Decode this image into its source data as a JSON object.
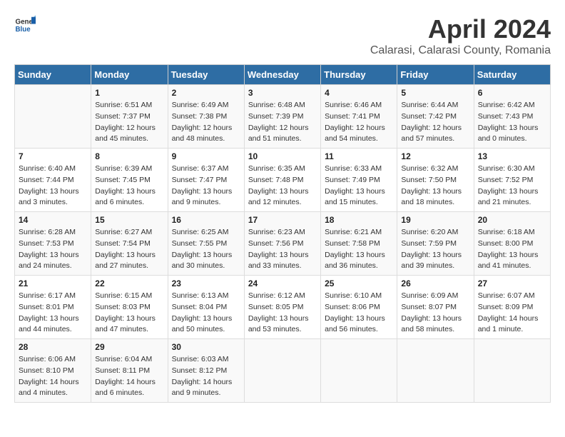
{
  "header": {
    "logo_general": "General",
    "logo_blue": "Blue",
    "title": "April 2024",
    "subtitle": "Calarasi, Calarasi County, Romania"
  },
  "calendar": {
    "days_of_week": [
      "Sunday",
      "Monday",
      "Tuesday",
      "Wednesday",
      "Thursday",
      "Friday",
      "Saturday"
    ],
    "weeks": [
      [
        {
          "day": "",
          "info": ""
        },
        {
          "day": "1",
          "info": "Sunrise: 6:51 AM\nSunset: 7:37 PM\nDaylight: 12 hours\nand 45 minutes."
        },
        {
          "day": "2",
          "info": "Sunrise: 6:49 AM\nSunset: 7:38 PM\nDaylight: 12 hours\nand 48 minutes."
        },
        {
          "day": "3",
          "info": "Sunrise: 6:48 AM\nSunset: 7:39 PM\nDaylight: 12 hours\nand 51 minutes."
        },
        {
          "day": "4",
          "info": "Sunrise: 6:46 AM\nSunset: 7:41 PM\nDaylight: 12 hours\nand 54 minutes."
        },
        {
          "day": "5",
          "info": "Sunrise: 6:44 AM\nSunset: 7:42 PM\nDaylight: 12 hours\nand 57 minutes."
        },
        {
          "day": "6",
          "info": "Sunrise: 6:42 AM\nSunset: 7:43 PM\nDaylight: 13 hours\nand 0 minutes."
        }
      ],
      [
        {
          "day": "7",
          "info": "Sunrise: 6:40 AM\nSunset: 7:44 PM\nDaylight: 13 hours\nand 3 minutes."
        },
        {
          "day": "8",
          "info": "Sunrise: 6:39 AM\nSunset: 7:45 PM\nDaylight: 13 hours\nand 6 minutes."
        },
        {
          "day": "9",
          "info": "Sunrise: 6:37 AM\nSunset: 7:47 PM\nDaylight: 13 hours\nand 9 minutes."
        },
        {
          "day": "10",
          "info": "Sunrise: 6:35 AM\nSunset: 7:48 PM\nDaylight: 13 hours\nand 12 minutes."
        },
        {
          "day": "11",
          "info": "Sunrise: 6:33 AM\nSunset: 7:49 PM\nDaylight: 13 hours\nand 15 minutes."
        },
        {
          "day": "12",
          "info": "Sunrise: 6:32 AM\nSunset: 7:50 PM\nDaylight: 13 hours\nand 18 minutes."
        },
        {
          "day": "13",
          "info": "Sunrise: 6:30 AM\nSunset: 7:52 PM\nDaylight: 13 hours\nand 21 minutes."
        }
      ],
      [
        {
          "day": "14",
          "info": "Sunrise: 6:28 AM\nSunset: 7:53 PM\nDaylight: 13 hours\nand 24 minutes."
        },
        {
          "day": "15",
          "info": "Sunrise: 6:27 AM\nSunset: 7:54 PM\nDaylight: 13 hours\nand 27 minutes."
        },
        {
          "day": "16",
          "info": "Sunrise: 6:25 AM\nSunset: 7:55 PM\nDaylight: 13 hours\nand 30 minutes."
        },
        {
          "day": "17",
          "info": "Sunrise: 6:23 AM\nSunset: 7:56 PM\nDaylight: 13 hours\nand 33 minutes."
        },
        {
          "day": "18",
          "info": "Sunrise: 6:21 AM\nSunset: 7:58 PM\nDaylight: 13 hours\nand 36 minutes."
        },
        {
          "day": "19",
          "info": "Sunrise: 6:20 AM\nSunset: 7:59 PM\nDaylight: 13 hours\nand 39 minutes."
        },
        {
          "day": "20",
          "info": "Sunrise: 6:18 AM\nSunset: 8:00 PM\nDaylight: 13 hours\nand 41 minutes."
        }
      ],
      [
        {
          "day": "21",
          "info": "Sunrise: 6:17 AM\nSunset: 8:01 PM\nDaylight: 13 hours\nand 44 minutes."
        },
        {
          "day": "22",
          "info": "Sunrise: 6:15 AM\nSunset: 8:03 PM\nDaylight: 13 hours\nand 47 minutes."
        },
        {
          "day": "23",
          "info": "Sunrise: 6:13 AM\nSunset: 8:04 PM\nDaylight: 13 hours\nand 50 minutes."
        },
        {
          "day": "24",
          "info": "Sunrise: 6:12 AM\nSunset: 8:05 PM\nDaylight: 13 hours\nand 53 minutes."
        },
        {
          "day": "25",
          "info": "Sunrise: 6:10 AM\nSunset: 8:06 PM\nDaylight: 13 hours\nand 56 minutes."
        },
        {
          "day": "26",
          "info": "Sunrise: 6:09 AM\nSunset: 8:07 PM\nDaylight: 13 hours\nand 58 minutes."
        },
        {
          "day": "27",
          "info": "Sunrise: 6:07 AM\nSunset: 8:09 PM\nDaylight: 14 hours\nand 1 minute."
        }
      ],
      [
        {
          "day": "28",
          "info": "Sunrise: 6:06 AM\nSunset: 8:10 PM\nDaylight: 14 hours\nand 4 minutes."
        },
        {
          "day": "29",
          "info": "Sunrise: 6:04 AM\nSunset: 8:11 PM\nDaylight: 14 hours\nand 6 minutes."
        },
        {
          "day": "30",
          "info": "Sunrise: 6:03 AM\nSunset: 8:12 PM\nDaylight: 14 hours\nand 9 minutes."
        },
        {
          "day": "",
          "info": ""
        },
        {
          "day": "",
          "info": ""
        },
        {
          "day": "",
          "info": ""
        },
        {
          "day": "",
          "info": ""
        }
      ]
    ]
  }
}
